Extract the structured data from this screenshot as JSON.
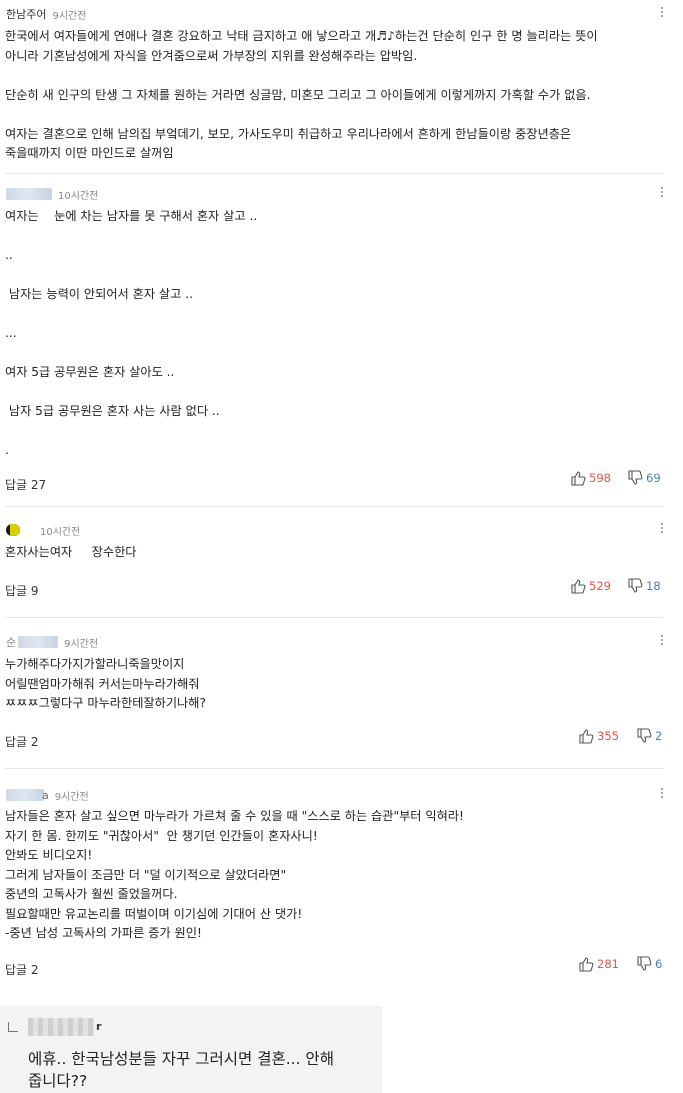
{
  "comments": [
    {
      "nick": "한남주어",
      "time": "9시간전",
      "body": "한국에서 여자들에게 연애나 결혼 강요하고 낙태 금지하고 애 낳으라고 개♬♪하는건 단순히 인구 한 명 늘리라는 뜻이\n아니라 기혼남성에게 자식을 안겨줌으로써 가부장의 지위를 완성해주라는 압박임.\n\n단순히 새 인구의 탄생 그 자체를 원하는 거라면 싱글맘, 미혼모 그리고 그 아이들에게 이렇게까지 가혹할 수가 없음.\n\n여자는 결혼으로 인해 남의집 부엌데기, 보모, 가사도우미 취급하고 우리나라에서 흔하게 한남들이랑 중장년층은\n죽을때까지 이딴 마인드로 살꺼임"
    },
    {
      "nick": "",
      "time": "10시간전",
      "body": "여자는    눈에 차는 남자를 못 구해서 혼자 살고 ..\n\n..\n\n 남자는 능력이 안되어서 혼자 살고 ..\n\n...\n\n여자 5급 공무원은 혼자 살아도 ..\n\n 남자 5급 공무원은 혼자 사는 사람 없다 ..\n\n.",
      "reply_label": "답글 27",
      "up": "598",
      "down": "69"
    },
    {
      "nick": "",
      "time": "10시간전",
      "body": "혼자사는여자     장수한다",
      "reply_label": "답글 9",
      "up": "529",
      "down": "18"
    },
    {
      "nick": "순",
      "time": "9시간전",
      "body": "누가해주다가지가할라니죽을맛이지\n어릴땐엄마가해줘 커서는마누라가해줘\nㅉㅉㅉ그렇다구 마누라한테잘하기나해?",
      "reply_label": "답글 2",
      "up": "355",
      "down": "2"
    },
    {
      "nick": "a",
      "time": "9시간전",
      "body": "남자들은 혼자 살고 싶으면 마누라가 가르쳐 줄 수 있을 때 \"스스로 하는 습관\"부터 익혀라!\n자기 한 몸. 한끼도 \"귀찮아서\"  안 챙기던 인간들이 혼자사니!\n안봐도 비디오지!\n그러게 남자들이 조금만 더 \"덜 이기적으로 살았더라면\"\n중년의 고독사가 훨씬 줄었을꺼다.\n필요할때만 유교논리를 떠벌이며 이기심에 기대어 산 댓가!\n-중년 남성 고독사의 가파른 증가 원인!",
      "reply_label": "답글 2",
      "up": "281",
      "down": "6"
    }
  ],
  "reply": {
    "nick_tail": "r",
    "text": "에휴.. 한국남성분들 자꾸 그러시면 결혼... 안해\n줍니다??"
  }
}
